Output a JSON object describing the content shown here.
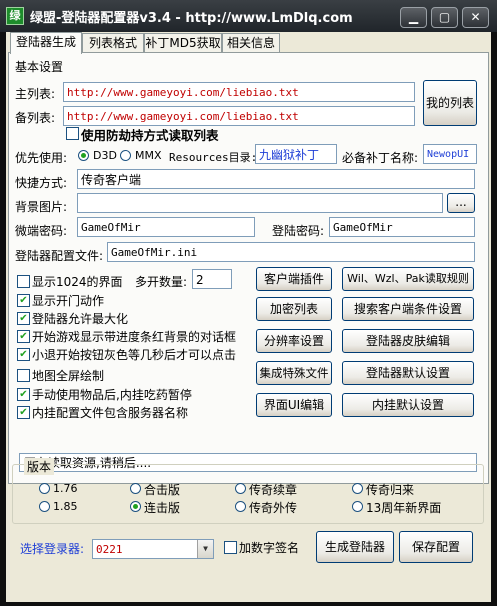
{
  "window": {
    "title": "绿盟-登陆器配置器v3.4 - http://www.LmDlq.com",
    "app_icon": "green-leaf-icon"
  },
  "tabs": [
    "登陆器生成",
    "列表格式",
    "补丁MD5获取",
    "相关信息"
  ],
  "basic_settings": {
    "heading": "基本设置",
    "main_list_label": "主列表:",
    "main_list_value": "http://www.gameyoyi.com/liebiao.txt",
    "backup_list_label": "备列表:",
    "backup_list_value": "http://www.gameyoyi.com/liebiao.txt",
    "my_list_button": "我的列表",
    "anti_hijack_label": "使用防劫持方式读取列表",
    "priority_label": "优先使用:",
    "radio_d3d": "D3D",
    "radio_mmx": "MMX",
    "resources_label": "Resources目录:",
    "resources_value": "九幽狱补丁",
    "patch_label": "必备补丁名称:",
    "patch_value": "NewopUI",
    "shortcut_label": "快捷方式:",
    "shortcut_value": "传奇客户端",
    "bg_image_label": "背景图片:",
    "bg_image_value": "",
    "browse_button": "...",
    "micro_password_label": "微端密码:",
    "micro_password_value": "GameOfMir",
    "login_password_label": "登陆密码:",
    "login_password_value": "GameOfMir",
    "config_file_label": "登陆器配置文件:",
    "config_file_value": "GameOfMir.ini"
  },
  "options": {
    "show_1024": "显示1024的界面",
    "multi_count_label": "多开数量:",
    "multi_count_value": "2",
    "show_door_anim": "显示开门动作",
    "allow_maximize": "登陆器允许最大化",
    "progress_dialog": "开始游戏显示带进度条红背景的对话框",
    "small_exit_gray": "小退开始按钮灰色等几秒后才可以点击",
    "fullscreen_map": "地图全屏绘制",
    "manual_items": "手动使用物品后,内挂吃药暂停",
    "include_server_name": "内挂配置文件包含服务器名称"
  },
  "buttons": {
    "client_plugin": "客户端插件",
    "wil_rules": "Wil、Wzl、Pak读取规则",
    "encrypt_list": "加密列表",
    "search_client": "搜索客户端条件设置",
    "resolution": "分辨率设置",
    "skin_edit": "登陆器皮肤编辑",
    "integrate_file": "集成特殊文件",
    "launcher_default": "登陆器默认设置",
    "ui_edit": "界面UI编辑",
    "plugin_default": "内挂默认设置"
  },
  "status_text": "正在读取资源,请稍后....",
  "version": {
    "heading": "版本",
    "options": [
      {
        "label": "1.76",
        "selected": false
      },
      {
        "label": "合击版",
        "selected": false
      },
      {
        "label": "传奇续章",
        "selected": false
      },
      {
        "label": "传奇归来",
        "selected": false
      },
      {
        "label": "1.85",
        "selected": false
      },
      {
        "label": "连击版",
        "selected": true
      },
      {
        "label": "传奇外传",
        "selected": false
      },
      {
        "label": "13周年新界面",
        "selected": false
      }
    ]
  },
  "footer": {
    "select_label": "选择登录器:",
    "select_value": "0221",
    "digital_sign": "加数字签名",
    "generate_button": "生成登陆器",
    "save_button": "保存配置"
  },
  "colors": {
    "accent_red": "#c00000",
    "title_blue": "#1f3fd6",
    "check_green": "#21a121"
  }
}
